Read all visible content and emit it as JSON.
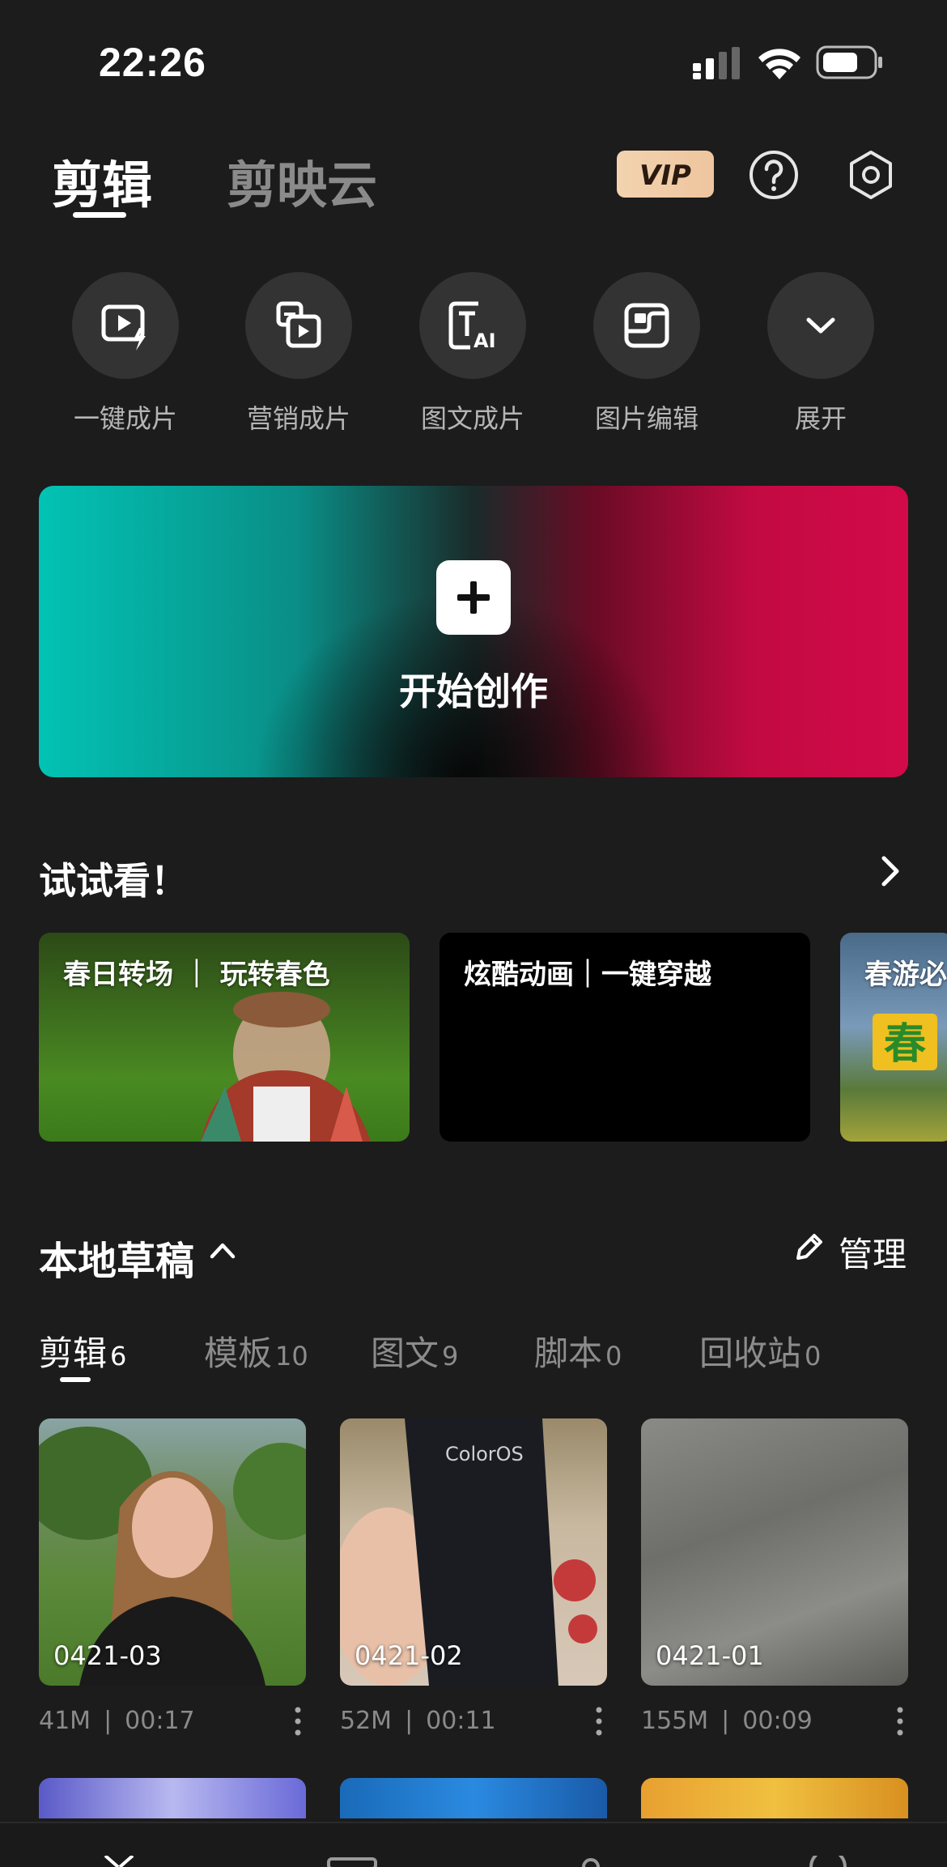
{
  "status_bar": {
    "time": "22:26"
  },
  "header": {
    "tabs": [
      {
        "label": "剪辑"
      },
      {
        "label": "剪映云"
      }
    ],
    "vip_label": "VIP"
  },
  "quick_actions": [
    {
      "label": "一键成片",
      "icon": "video-magic-icon"
    },
    {
      "label": "营销成片",
      "icon": "marketing-video-icon"
    },
    {
      "label": "图文成片",
      "icon": "text-ai-icon"
    },
    {
      "label": "图片编辑",
      "icon": "image-edit-icon"
    },
    {
      "label": "展开",
      "icon": "chevron-down-icon"
    }
  ],
  "hero": {
    "label": "开始创作"
  },
  "try_section": {
    "title": "试试看！",
    "cards": [
      {
        "title": "春日转场 ｜ 玩转春色"
      },
      {
        "title": "炫酷动画｜一键穿越"
      },
      {
        "title": "春游必"
      }
    ]
  },
  "drafts": {
    "title": "本地草稿",
    "manage_label": "管理",
    "tabs": [
      {
        "label": "剪辑",
        "count": "6"
      },
      {
        "label": "模板",
        "count": "10"
      },
      {
        "label": "图文",
        "count": "9"
      },
      {
        "label": "脚本",
        "count": "0"
      },
      {
        "label": "回收站",
        "count": "0"
      }
    ],
    "items": [
      {
        "name": "0421-03",
        "size": "41M",
        "duration": "00:17"
      },
      {
        "name": "0421-02",
        "size": "52M",
        "duration": "00:11"
      },
      {
        "name": "0421-01",
        "size": "155M",
        "duration": "00:09"
      }
    ]
  },
  "colors": {
    "background": "#1c1c1c",
    "vip_gold": "#f0c9a3",
    "hero_teal": "#02c3b4",
    "hero_crimson": "#d30a4a"
  }
}
